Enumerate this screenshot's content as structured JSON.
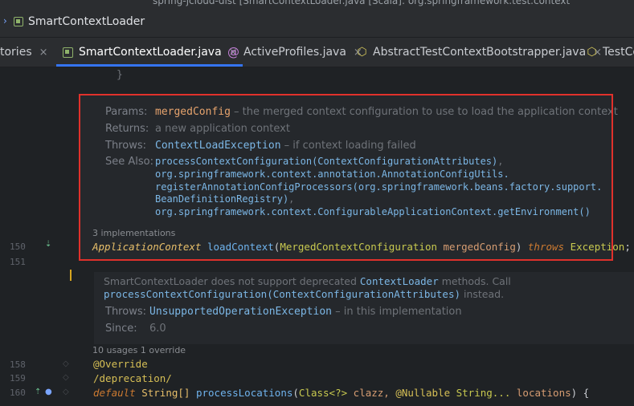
{
  "titlebar": {
    "text": "spring-jcloud-dist [SmartContextLoader.java [Scala]: org.springframework.test.context"
  },
  "breadcrumb": {
    "label": "SmartContextLoader"
  },
  "tabs": [
    {
      "label": "tories",
      "close": "×"
    },
    {
      "label": "SmartContextLoader.java",
      "close": "×"
    },
    {
      "label": "ActiveProfiles.java",
      "close": "×"
    },
    {
      "label": "AbstractTestContextBootstrapper.java",
      "close": "×"
    },
    {
      "label": "TestCo",
      "close": ""
    }
  ],
  "doc1": {
    "brace": "}",
    "params_label": "Params:",
    "params_name": "mergedConfig",
    "params_desc": " – the merged context configuration to use to load the application context",
    "returns_label": "Returns:",
    "returns_desc": "a new application context",
    "throws_label": "Throws:",
    "throws_ex": "ContextLoadException",
    "throws_desc": " – if context loading failed",
    "seealso_label": "See Also:",
    "seealso_l1": "processContextConfiguration(ContextConfigurationAttributes)",
    "seealso_l1b": ",",
    "seealso_l2": "org.springframework.context.annotation.AnnotationConfigUtils.",
    "seealso_l3": "registerAnnotationConfigProcessors(org.springframework.beans.factory.support.",
    "seealso_l4": "BeanDefinitionRegistry)",
    "seealso_l4b": ",",
    "seealso_l5": "org.springframework.context.ConfigurableApplicationContext.getEnvironment()"
  },
  "impl_count": "3 implementations",
  "code150": {
    "type": "ApplicationContext",
    "method": "loadContext",
    "arg_type": "MergedContextConfiguration",
    "arg_name": "mergedConfig",
    "throws": "throws",
    "ex": "Exception",
    "end": ";"
  },
  "lines": {
    "l150": "150",
    "l151": "151",
    "l158": "158",
    "l159": "159",
    "l160": "160"
  },
  "doc2": {
    "l1a": "SmartContextLoader does not support deprecated ",
    "l1b": "ContextLoader",
    "l1c": " methods. Call",
    "l2a": "processContextConfiguration(ContextConfigurationAttributes)",
    "l2b": " instead.",
    "throws_label": "Throws:",
    "throws_ex": "UnsupportedOperationException",
    "throws_desc": " – in this implementation",
    "since_label": "Since:",
    "since_val": "6.0"
  },
  "usages": "10 usages   1 override",
  "code158": "@Override",
  "code159": "/deprecation/",
  "code160": {
    "kw": "default",
    "type": "String[]",
    "method": "processLocations",
    "p1type": "Class<?>",
    "p1": "clazz,",
    "ann": "@Nullable",
    "p2type": "String...",
    "p2": "locations",
    "end": ") {"
  }
}
